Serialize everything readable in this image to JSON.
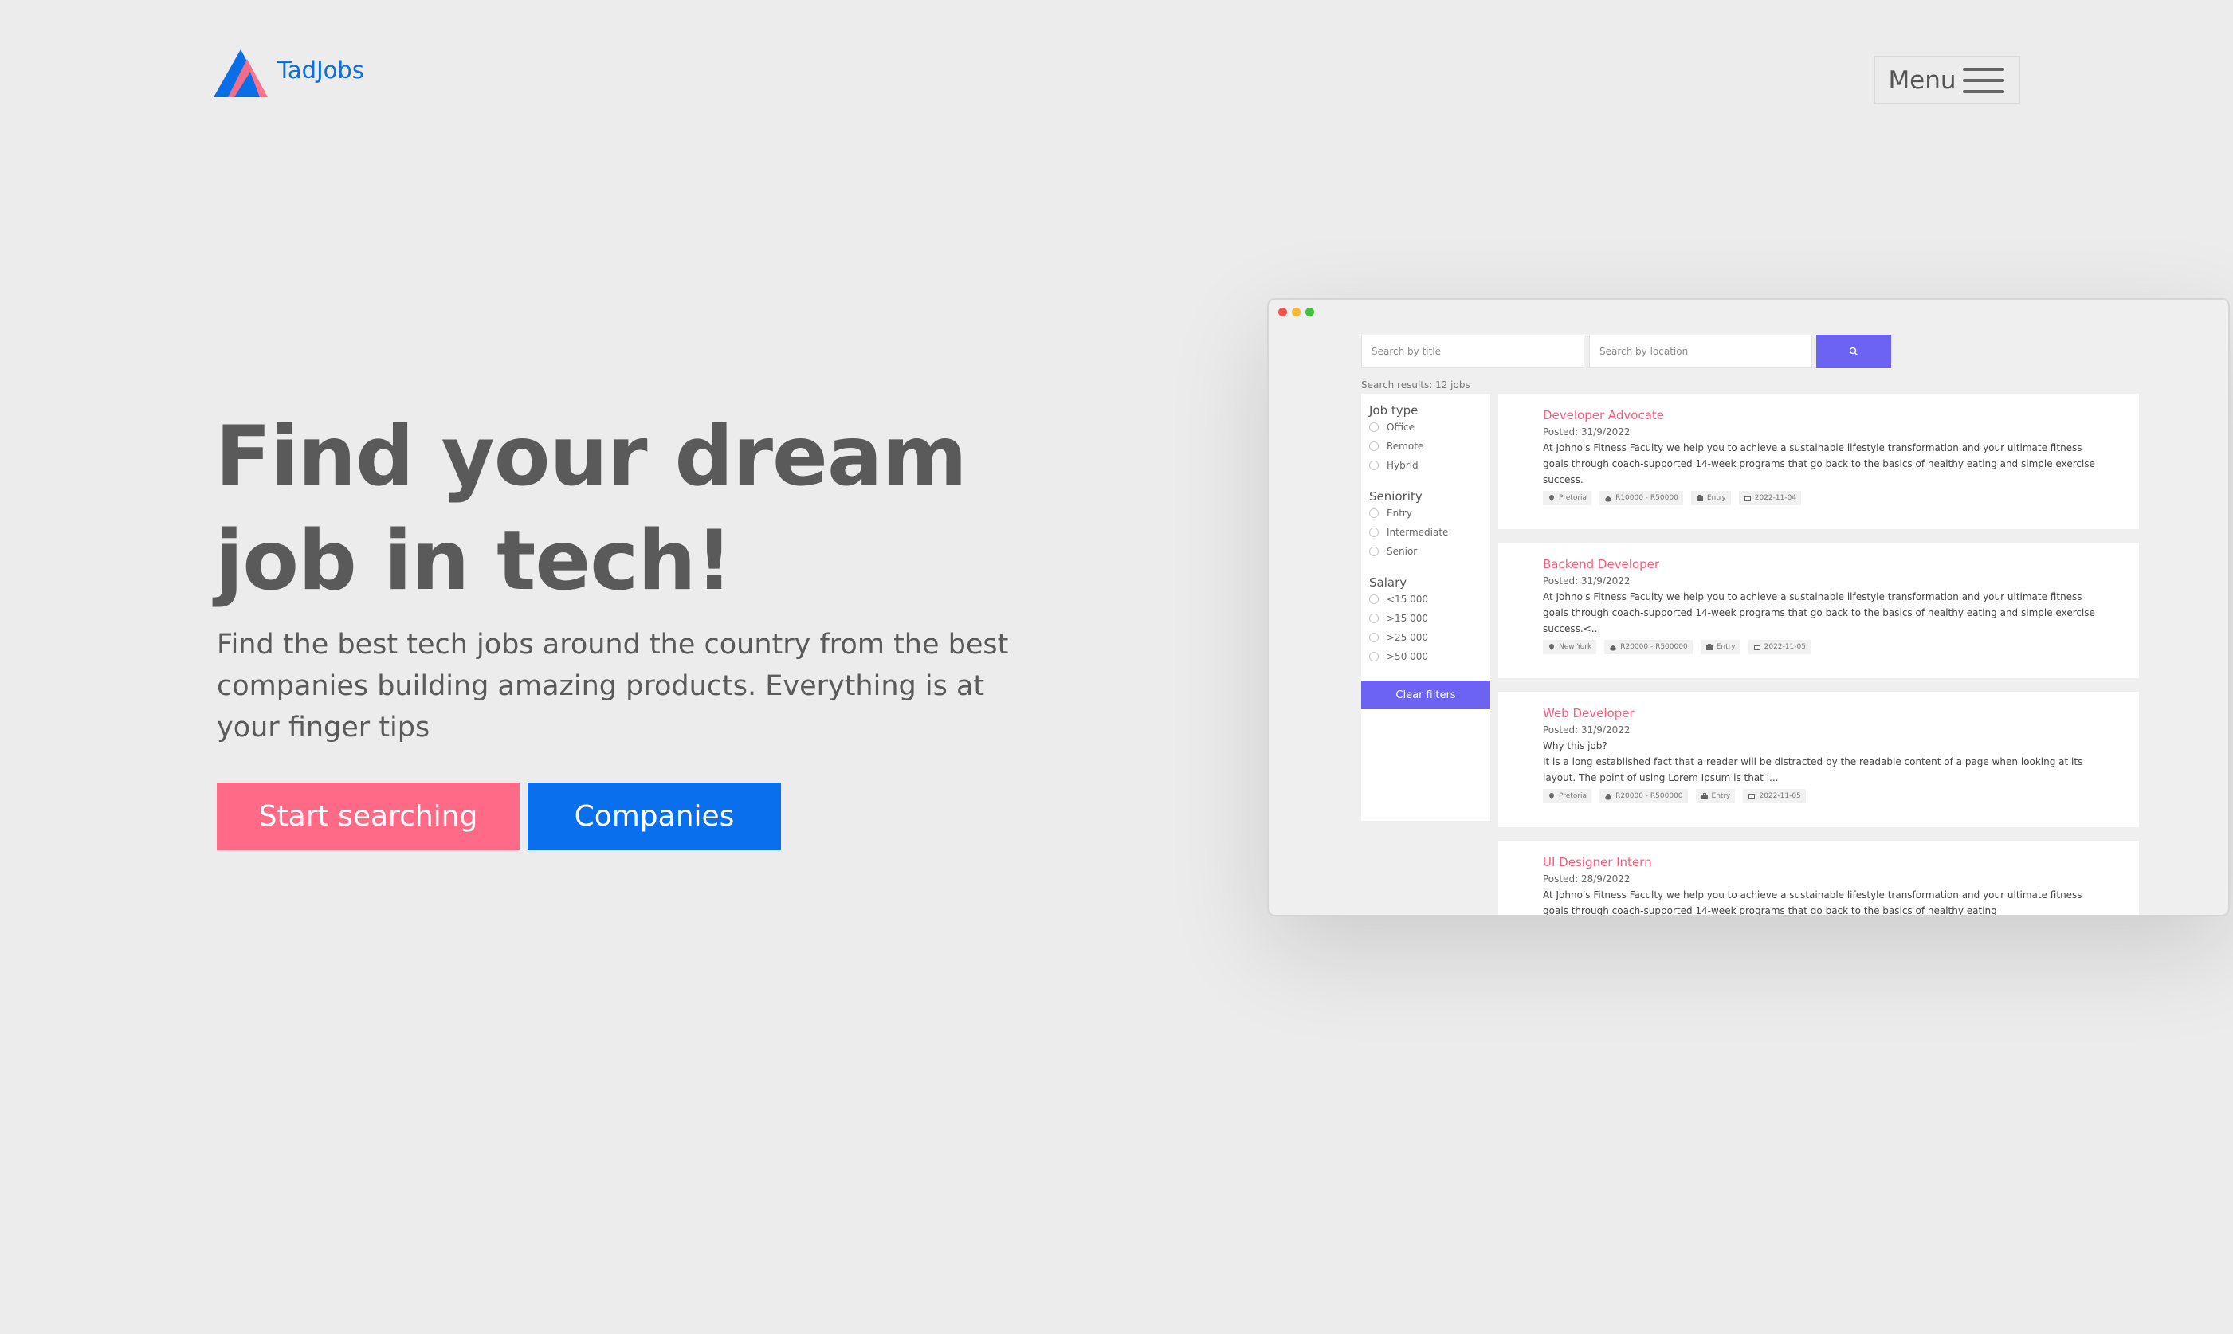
{
  "brand": {
    "name": "TadJobs",
    "colors": {
      "blue": "#0a6fe6",
      "pink": "#ff6b86"
    }
  },
  "header": {
    "menu_label": "Menu",
    "menu_icon": "hamburger-icon"
  },
  "hero": {
    "title_line1": "Find your dream",
    "title_line2": "job in tech!",
    "subtitle": "Find the best tech jobs around the country from the best companies building amazing products. Everything is at your finger tips",
    "primary_button": "Start searching",
    "secondary_button": "Companies"
  },
  "mockup": {
    "search_title_placeholder": "Search by title",
    "search_location_placeholder": "Search by location",
    "search_icon": "search-icon",
    "results_text": "Search results: 12 jobs",
    "filters": {
      "job_type": {
        "heading": "Job type",
        "options": [
          "Office",
          "Remote",
          "Hybrid"
        ]
      },
      "seniority": {
        "heading": "Seniority",
        "options": [
          "Entry",
          "Intermediate",
          "Senior"
        ]
      },
      "salary": {
        "heading": "Salary",
        "options": [
          "<15 000",
          ">15 000",
          ">25 000",
          ">50 000"
        ]
      },
      "clear_label": "Clear filters"
    },
    "jobs": [
      {
        "title": "Developer Advocate",
        "posted": "Posted: 31/9/2022",
        "intro": "",
        "desc": "At Johno's Fitness Faculty we help you to achieve a sustainable lifestyle transformation and your ultimate fitness goals through coach-supported 14-week programs that go back to the basics of healthy eating and simple exercise success.",
        "tags": {
          "location": "Pretoria",
          "salary": "R10000 - R50000",
          "level": "Entry",
          "date": "2022-11-04"
        }
      },
      {
        "title": "Backend Developer",
        "posted": "Posted: 31/9/2022",
        "intro": "",
        "desc": "At Johno's Fitness Faculty we help you to achieve a sustainable lifestyle transformation and your ultimate fitness goals through coach-supported 14-week programs that go back to the basics of healthy eating and simple exercise success.<...",
        "tags": {
          "location": "New York",
          "salary": "R20000 - R500000",
          "level": "Entry",
          "date": "2022-11-05"
        }
      },
      {
        "title": "Web Developer",
        "posted": "Posted: 31/9/2022",
        "intro": "Why this job?",
        "desc": "It is a long established fact that a reader will be distracted by the readable content of a page when looking at its layout. The point of using Lorem Ipsum is that i...",
        "tags": {
          "location": "Pretoria",
          "salary": "R20000 - R500000",
          "level": "Entry",
          "date": "2022-11-05"
        }
      },
      {
        "title": "UI Designer Intern",
        "posted": "Posted: 28/9/2022",
        "intro": "",
        "desc": "At Johno's Fitness Faculty we help you to achieve a sustainable lifestyle transformation and your ultimate fitness goals through coach-supported 14-week programs that go back to the basics of healthy eating",
        "tags": {
          "location": "",
          "salary": "",
          "level": "",
          "date": ""
        }
      }
    ]
  }
}
